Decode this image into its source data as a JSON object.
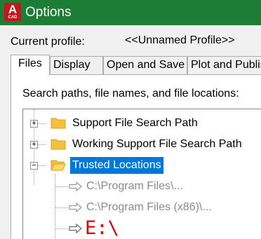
{
  "window": {
    "title": "Options",
    "app_icon_letter": "A",
    "app_icon_sub": "CAD"
  },
  "profile": {
    "label": "Current profile:",
    "value": "<<Unnamed Profile>>"
  },
  "tabs": [
    {
      "label": "Files"
    },
    {
      "label": "Display"
    },
    {
      "label": "Open and Save"
    },
    {
      "label": "Plot and Publish"
    }
  ],
  "files_panel": {
    "caption": "Search paths, file names, and file locations:",
    "tree": [
      {
        "label": "Support File Search Path",
        "expander": "+"
      },
      {
        "label": "Working Support File Search Path",
        "expander": "+"
      },
      {
        "label": "Trusted Locations",
        "expander": "−"
      }
    ],
    "trusted_children": [
      {
        "label": "C:\\Program Files\\..."
      },
      {
        "label": "C:\\Program Files (x86)\\..."
      },
      {
        "label": "E:\\"
      }
    ]
  },
  "colors": {
    "titlebar": "#1e7d34",
    "selection": "#0078d7",
    "highlight_text": "#e00000",
    "folder": "#f5c13d"
  }
}
